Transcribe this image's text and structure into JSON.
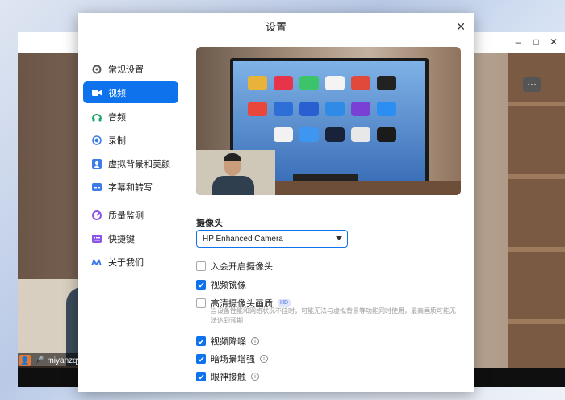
{
  "dialog": {
    "title": "设置",
    "close_icon": "close-icon"
  },
  "window_controls": {
    "minimize": "–",
    "maximize": "□",
    "close": "✕"
  },
  "more_button": "···",
  "sidebar": {
    "items": [
      {
        "label": "常规设置",
        "icon": "gear-icon"
      },
      {
        "label": "视频",
        "icon": "video-camera-icon",
        "active": true
      },
      {
        "label": "音频",
        "icon": "headphones-icon"
      },
      {
        "label": "录制",
        "icon": "record-icon"
      },
      {
        "label": "虚拟背景和美颜",
        "icon": "person-background-icon"
      },
      {
        "label": "字幕和转写",
        "icon": "caption-icon"
      },
      {
        "label": "质量监测",
        "icon": "gauge-icon"
      },
      {
        "label": "快捷键",
        "icon": "keyboard-icon"
      },
      {
        "label": "关于我们",
        "icon": "logo-icon"
      }
    ]
  },
  "camera": {
    "label": "摄像头",
    "selected": "HP Enhanced Camera"
  },
  "options": [
    {
      "label": "入会开启摄像头",
      "checked": false
    },
    {
      "label": "视频镜像",
      "checked": true
    },
    {
      "label": "高清摄像头画质",
      "checked": false,
      "badge": "HD"
    },
    {
      "label": "视频降噪",
      "checked": true,
      "info": true
    },
    {
      "label": "暗场景增强",
      "checked": true,
      "info": true
    },
    {
      "label": "眼神接触",
      "checked": true,
      "info": true
    }
  ],
  "hd_note": "当设备性能和网络状况不佳时，可能无法与虚拟背景等功能同时使用，最高画质可能无法达到预期",
  "participant": {
    "name": "miyanzqy"
  },
  "colors": {
    "accent": "#0e72ed"
  }
}
